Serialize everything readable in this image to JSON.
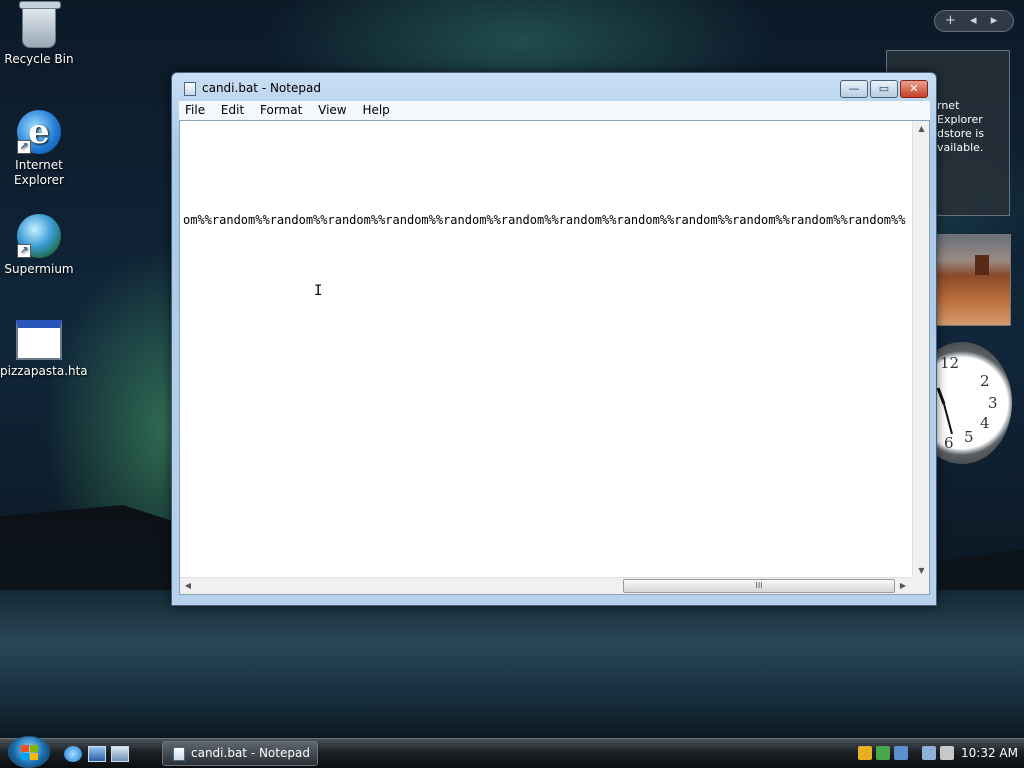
{
  "desktop": {
    "icons": [
      {
        "label": "Recycle Bin"
      },
      {
        "label": "Internet Explorer"
      },
      {
        "label": "Supermium"
      },
      {
        "label": "pizzapasta.hta"
      }
    ]
  },
  "sidebar": {
    "controls": [
      "+",
      "◂",
      "▸"
    ],
    "feed_text": "rnet Explorer dstore is vailable.",
    "clock_numbers": [
      "12",
      "2",
      "3",
      "4",
      "5",
      "6"
    ]
  },
  "notepad": {
    "title": "candi.bat - Notepad",
    "menu": [
      "File",
      "Edit",
      "Format",
      "View",
      "Help"
    ],
    "content_line": "om%%random%%random%%random%%random%%random%%random%%random%%random%%random%%random%%random%%random%%",
    "buttons": {
      "minimize": "—",
      "maximize": "▭",
      "close": "✕"
    },
    "scroll_glyphs": {
      "up": "▲",
      "down": "▼",
      "left": "◀",
      "right": "▶",
      "thumb": "III"
    }
  },
  "taskbar": {
    "task_label": "candi.bat - Notepad",
    "clock": "10:32 AM"
  },
  "colors": {
    "accent": "#2855b8",
    "titlebar": "#c9dff3",
    "close": "#c8402a"
  }
}
